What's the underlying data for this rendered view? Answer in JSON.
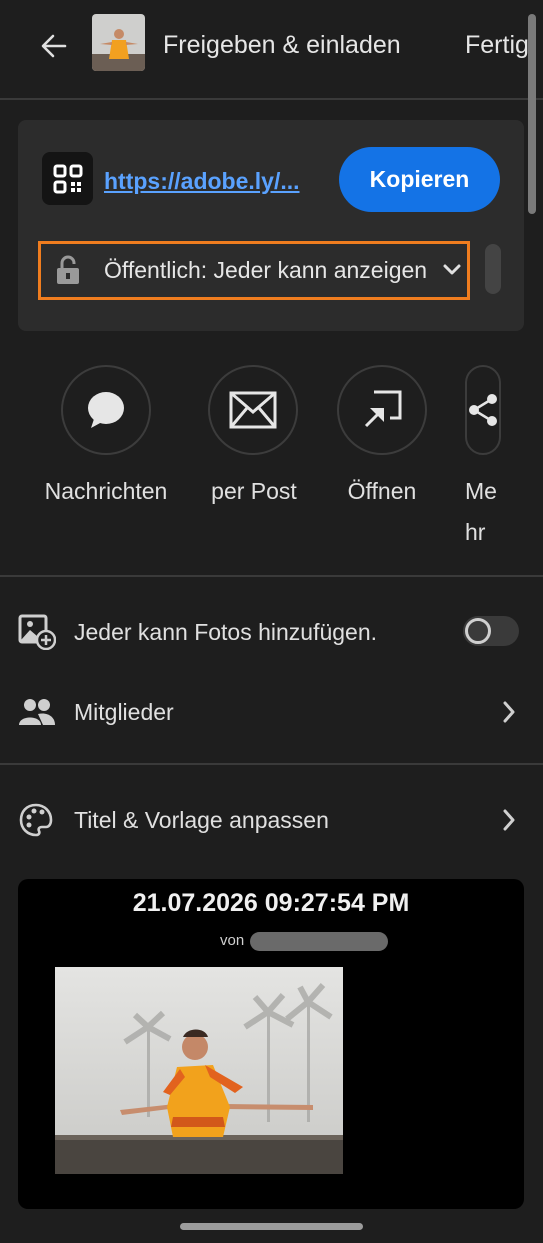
{
  "header": {
    "back_icon": "arrow-left-icon",
    "title": "Freigeben & einladen",
    "done_label": "Fertig"
  },
  "link_card": {
    "qr_icon": "qr-code-icon",
    "url": "https://adobe.ly/...",
    "copy_label": "Kopieren",
    "privacy_icon": "lock-open-icon",
    "privacy_label": "Öffentlich: Jeder kann anzeigen",
    "accent_color": "#1473e6",
    "highlight_color": "#f07d1f"
  },
  "share_targets": [
    {
      "label": "Nachrichten",
      "icon": "message-bubble-icon"
    },
    {
      "label": "per Post",
      "icon": "envelope-icon"
    },
    {
      "label": "Öffnen",
      "icon": "open-external-icon"
    },
    {
      "label": "Me hr",
      "label_line1": "Me",
      "label_line2": "hr",
      "icon": "share-icon"
    }
  ],
  "settings": {
    "allow_add_label": "Jeder kann Fotos hinzufügen.",
    "allow_add_enabled": false,
    "members_label": "Mitglieder",
    "customize_label": "Titel & Vorlage anpassen"
  },
  "preview": {
    "date": "21.07.2026 09:27:54 PM",
    "by_label": "von"
  }
}
